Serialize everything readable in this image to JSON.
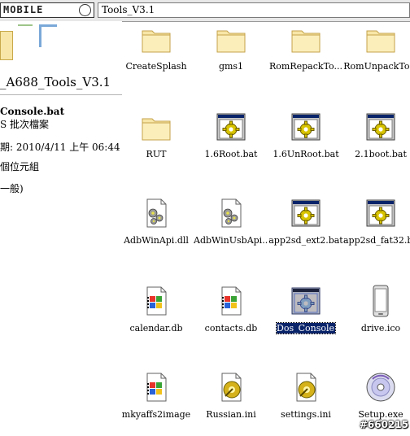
{
  "address_bar": {
    "path": "Tools_V3.1"
  },
  "details_pane": {
    "folder_name": "_A688_Tools_V3.1",
    "selected_file": "Console.bat",
    "file_type": "S 批次檔案",
    "modified": "期: 2010/4/11 上午 06:44",
    "size": "個位元組",
    "attributes": "一般)"
  },
  "files": [
    {
      "name": "CreateSplash",
      "icon": "folder-icon"
    },
    {
      "name": "gms1",
      "icon": "folder-icon"
    },
    {
      "name": "RomRepackTo...",
      "icon": "folder-icon"
    },
    {
      "name": "RomUnpackTo...",
      "icon": "folder-icon"
    },
    {
      "name": "RUT",
      "icon": "folder-icon"
    },
    {
      "name": "1.6Root.bat",
      "icon": "batch-file-icon"
    },
    {
      "name": "1.6UnRoot.bat",
      "icon": "batch-file-icon"
    },
    {
      "name": "2.1boot.bat",
      "icon": "batch-file-icon"
    },
    {
      "name": "AdbWinApi.dll",
      "icon": "dll-file-icon"
    },
    {
      "name": "AdbWinUsbApi....",
      "icon": "dll-file-icon"
    },
    {
      "name": "app2sd_ext2.bat",
      "icon": "batch-file-icon"
    },
    {
      "name": "app2sd_fat32.ba",
      "icon": "batch-file-icon"
    },
    {
      "name": "calendar.db",
      "icon": "windows-file-icon"
    },
    {
      "name": "contacts.db",
      "icon": "windows-file-icon"
    },
    {
      "name": "Dos_Console.bat",
      "icon": "batch-file-icon",
      "selected": true
    },
    {
      "name": "drive.ico",
      "icon": "phone-icon"
    },
    {
      "name": "mkyaffs2image",
      "icon": "windows-file-icon"
    },
    {
      "name": "Russian.ini",
      "icon": "ini-file-icon"
    },
    {
      "name": "settings.ini",
      "icon": "ini-file-icon"
    },
    {
      "name": "Setup.exe",
      "icon": "cd-setup-icon"
    }
  ],
  "watermark": "#660215",
  "colors": {
    "selection": "#0a246a",
    "folder": "#f7e6a7",
    "batch_window": "#0a246a"
  }
}
